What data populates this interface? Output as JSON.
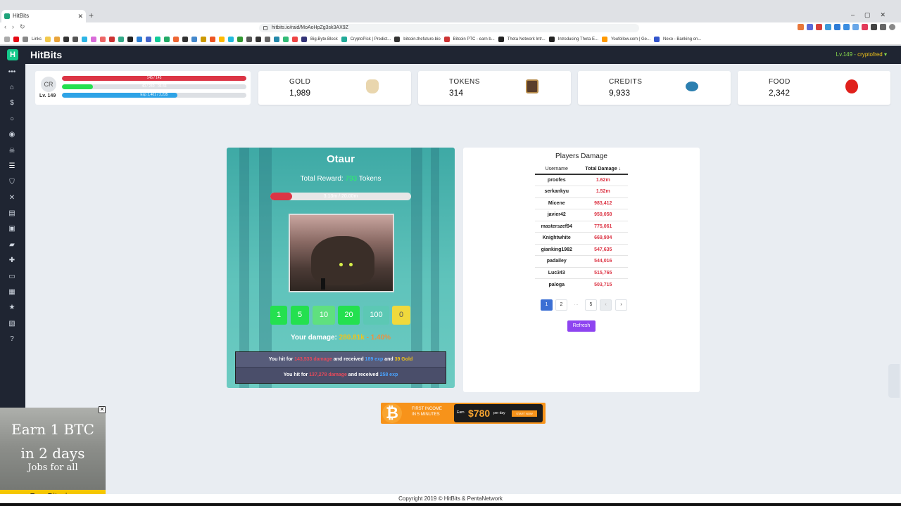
{
  "browser": {
    "tab_title": "HitBits",
    "url": "hitbits.io/raid/MoAoHpZg3sk3AX9Z",
    "bookmarks": [
      "Links",
      "Big.Byte.Block",
      "CryptoPick | Predict...",
      "bitcoin.thefuture.bio",
      "Bitcoin PTC - earn b...",
      "Theta Network Intr...",
      "Introducing Theta E...",
      "Youfollow.com | Ge...",
      "Nexo - Banking on..."
    ]
  },
  "app": {
    "brand": "HitBits",
    "user_level": "Lv.149",
    "user_name": "cryptofred",
    "user_sep": " - "
  },
  "profile": {
    "initials": "CR",
    "level": "Lv. 149",
    "hp_text": "145 / 145",
    "hp_fraction": 1.0,
    "energy_text": "40 / 240 · 06:33",
    "energy_fraction": 0.167,
    "exp_text": "Exp 1,401 / 2,235",
    "exp_fraction": 0.627
  },
  "stats": [
    {
      "label": "GOLD",
      "value": "1,989",
      "icon": "gold-bag-icon"
    },
    {
      "label": "TOKENS",
      "value": "314",
      "icon": "token-chest-icon"
    },
    {
      "label": "CREDITS",
      "value": "9,933",
      "icon": "credits-icon"
    },
    {
      "label": "FOOD",
      "value": "2,342",
      "icon": "apple-icon"
    }
  ],
  "raid": {
    "boss_name": "Otaur",
    "reward_prefix": "Total Reward: ",
    "reward_tokens": "793",
    "reward_suffix": " Tokens",
    "hp_text": "3.13m / 20.00m",
    "hp_fraction": 0.157,
    "hit_buttons": [
      "1",
      "5",
      "10",
      "20",
      "100",
      "0"
    ],
    "your_damage_label": "Your damage: ",
    "your_damage": "280.81k",
    "your_damage_sep": " - ",
    "your_damage_pct": "1.40%",
    "log": [
      {
        "p1": "You hit for ",
        "dmg": "143,533 damage",
        "p2": " and received ",
        "exp": "189 exp",
        "p3": " and ",
        "gold": "39 Gold"
      },
      {
        "p1": "You hit for ",
        "dmg": "137,278 damage",
        "p2": " and received ",
        "exp": "258 exp",
        "p3": "",
        "gold": ""
      }
    ]
  },
  "players_damage": {
    "title": "Players Damage",
    "col_username": "Username",
    "col_damage": "Total Damage",
    "sort_icon": "↓",
    "rows": [
      [
        "proofes",
        "1.62m"
      ],
      [
        "serkankyu",
        "1.52m"
      ],
      [
        "Micene",
        "983,412"
      ],
      [
        "javier42",
        "959,058"
      ],
      [
        "masterszef94",
        "775,061"
      ],
      [
        "Knightwhite",
        "669,904"
      ],
      [
        "gianking1982",
        "547,635"
      ],
      [
        "padailey",
        "544,016"
      ],
      [
        "Luc343",
        "515,765"
      ],
      [
        "paloga",
        "503,715"
      ]
    ],
    "pages": [
      "1",
      "2",
      "...",
      "5",
      "‹",
      "›"
    ],
    "refresh_label": "Refresh"
  },
  "banner": {
    "line1": "FIRST INCOME",
    "line2": "IN 5 MINUTES",
    "earn": "Earn",
    "amount": "$780",
    "per": "per day",
    "cta": "START NOW"
  },
  "left_ad": {
    "line1": "Earn 1 BTC",
    "line2": "in 2 days",
    "line3": "Jobs for all",
    "button": "Earn Bitcoins"
  },
  "footer": "Copyright 2019 © HitBits & PentaNetwork",
  "colors": {
    "topbar": "#1f2532",
    "hp": "#dc3545",
    "energy": "#24e04f",
    "exp": "#2ea3e6",
    "hit_button": "#24e04f",
    "refresh": "#8e44f0"
  }
}
